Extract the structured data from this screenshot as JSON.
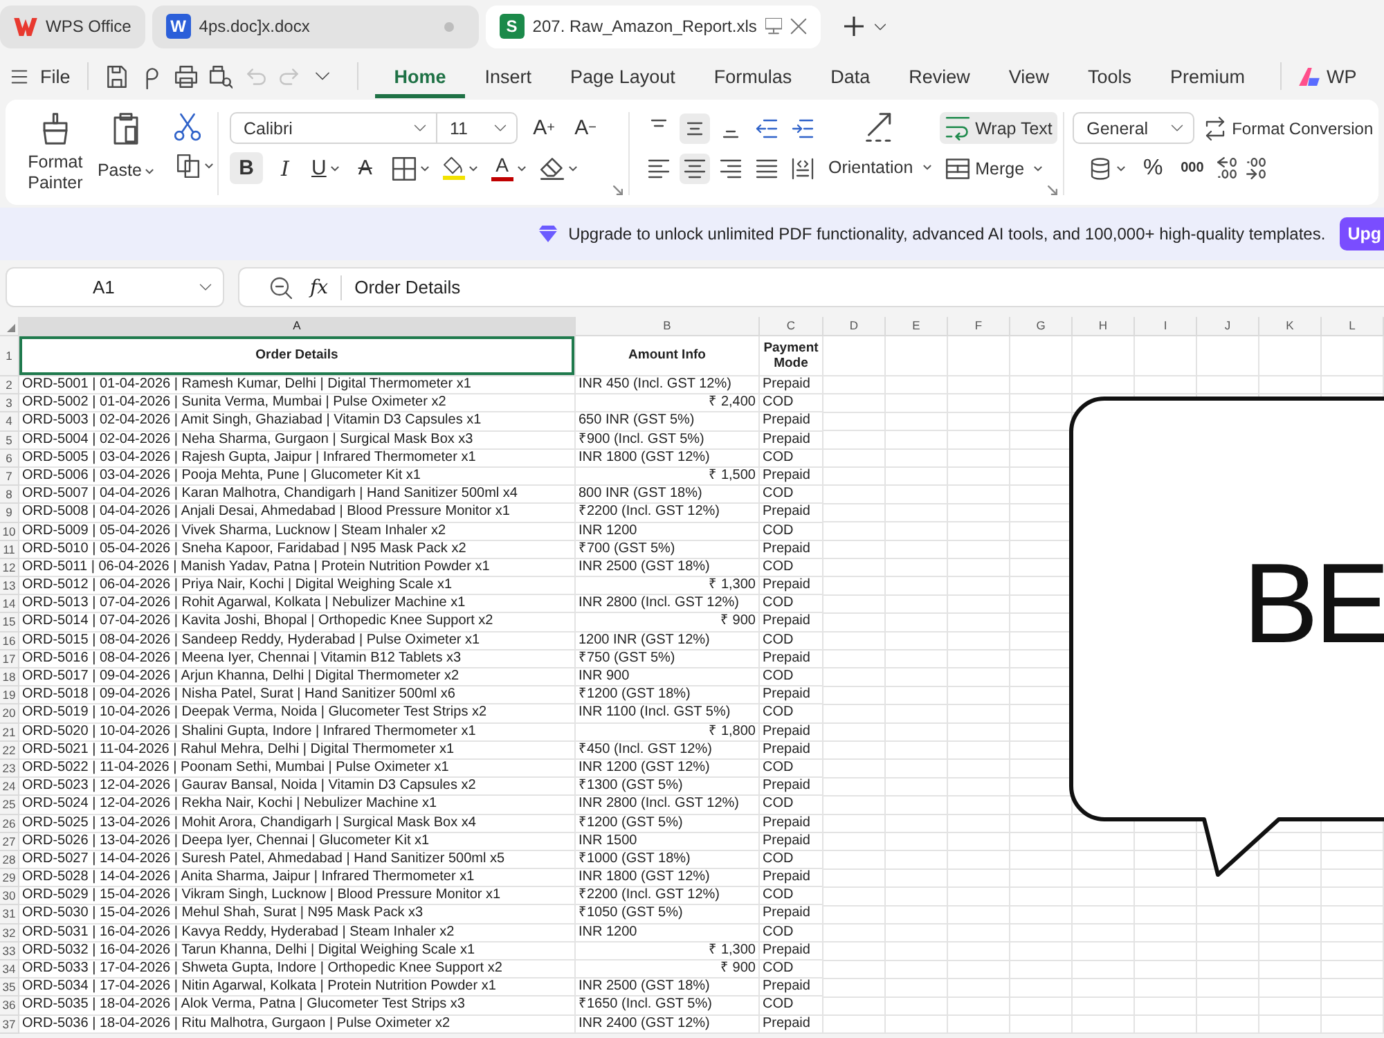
{
  "tabs": [
    {
      "kind": "home",
      "label": "WPS Office",
      "selected": false,
      "unsaved": false
    },
    {
      "kind": "writer",
      "badge": "W",
      "label": "4ps.doc]x.docx",
      "selected": false,
      "unsaved": true
    },
    {
      "kind": "sheet",
      "badge": "S",
      "label": "207. Raw_Amazon_Report.xls",
      "selected": true,
      "unsaved": false
    }
  ],
  "menu": {
    "file": "File",
    "quick_access": [
      {
        "kind": "save",
        "disabled": false
      },
      {
        "kind": "hook",
        "disabled": false
      },
      {
        "kind": "print",
        "disabled": false
      },
      {
        "kind": "preview",
        "disabled": false
      },
      {
        "kind": "undo",
        "disabled": true
      },
      {
        "kind": "redo",
        "disabled": true
      },
      {
        "kind": "more",
        "disabled": false
      }
    ],
    "tabs": [
      {
        "label": "Home",
        "selected": true
      },
      {
        "label": "Insert",
        "selected": false
      },
      {
        "label": "Page Layout",
        "selected": false
      },
      {
        "label": "Formulas",
        "selected": false
      },
      {
        "label": "Data",
        "selected": false
      },
      {
        "label": "Review",
        "selected": false
      },
      {
        "label": "View",
        "selected": false
      },
      {
        "label": "Tools",
        "selected": false
      },
      {
        "label": "Premium",
        "selected": false
      }
    ],
    "ai_label": "WP"
  },
  "ribbon": {
    "clipboard": {
      "format_painter": "Format Painter",
      "paste": "Paste"
    },
    "font": {
      "name": "Calibri",
      "size": "11",
      "grow": "A$^{+}$",
      "shrink": "A$^{−}$",
      "styles": [
        {
          "kind": "bold",
          "label": "B",
          "selected": true
        },
        {
          "kind": "italic",
          "label": "I",
          "selected": false
        },
        {
          "kind": "underline",
          "label": "U",
          "selected": false
        },
        {
          "kind": "strike",
          "label": "A",
          "selected": false
        }
      ],
      "colors": [
        {
          "kind": "highlight",
          "color": "#f2e200"
        },
        {
          "kind": "font",
          "label": "A",
          "color": "#c00000"
        }
      ]
    },
    "alignment": {
      "vertical": [
        {
          "kind": "top",
          "selected": false
        },
        {
          "kind": "middle",
          "selected": true
        },
        {
          "kind": "bottom",
          "selected": false
        }
      ],
      "horizontal": [
        {
          "kind": "left",
          "selected": false
        },
        {
          "kind": "center",
          "selected": true
        },
        {
          "kind": "right",
          "selected": false
        },
        {
          "kind": "justify",
          "selected": false
        },
        {
          "kind": "distributed",
          "selected": false
        }
      ],
      "orientation": "Orientation",
      "wrap_text": {
        "label": "Wrap Text",
        "selected": true
      },
      "merge": "Merge"
    },
    "number": {
      "format": "General",
      "conversion": "Format Conversion",
      "percent": "%",
      "thousands": "000"
    }
  },
  "banner": {
    "text": "Upgrade to unlock unlimited PDF functionality, advanced AI tools, and 100,000+ high-quality templates.",
    "button": "Upg"
  },
  "formula_bar": {
    "cell": "A1",
    "fx": "fx",
    "value": "Order Details"
  },
  "sheet": {
    "columns": [
      {
        "label": "A",
        "selected": true
      },
      {
        "label": "B",
        "selected": false
      },
      {
        "label": "C",
        "selected": false
      },
      {
        "label": "D",
        "selected": false
      },
      {
        "label": "E",
        "selected": false
      },
      {
        "label": "F",
        "selected": false
      },
      {
        "label": "G",
        "selected": false
      },
      {
        "label": "H",
        "selected": false
      },
      {
        "label": "I",
        "selected": false
      },
      {
        "label": "J",
        "selected": false
      },
      {
        "label": "K",
        "selected": false
      },
      {
        "label": "L",
        "selected": false
      }
    ],
    "header": {
      "number": "1",
      "cells": [
        {
          "text": "Order Details",
          "selected": true
        },
        {
          "text": "Amount Info",
          "selected": false
        },
        {
          "text": "Payment Mode",
          "selected": false
        }
      ]
    },
    "rows": [
      {
        "number": "2",
        "order": "ORD-5001 | 01-04-2026 | Ramesh Kumar, Delhi | Digital Thermometer x1",
        "amount": {
          "kind": "text",
          "text": "INR 450 (Incl. GST 12%)"
        },
        "payment": "Prepaid"
      },
      {
        "number": "3",
        "order": "ORD-5002 | 01-04-2026 | Sunita Verma, Mumbai | Pulse Oximeter x2",
        "amount": {
          "kind": "number",
          "text": "₹ 2,400"
        },
        "payment": "COD"
      },
      {
        "number": "4",
        "order": "ORD-5003 | 02-04-2026 | Amit Singh, Ghaziabad | Vitamin D3 Capsules x1",
        "amount": {
          "kind": "text",
          "text": "650 INR (GST 5%)"
        },
        "payment": "Prepaid"
      },
      {
        "number": "5",
        "order": "ORD-5004 | 02-04-2026 | Neha Sharma, Gurgaon | Surgical Mask Box x3",
        "amount": {
          "kind": "text",
          "text": "₹900 (Incl. GST 5%)"
        },
        "payment": "Prepaid"
      },
      {
        "number": "6",
        "order": "ORD-5005 | 03-04-2026 | Rajesh Gupta, Jaipur | Infrared Thermometer x1",
        "amount": {
          "kind": "text",
          "text": "INR 1800 (GST 12%)"
        },
        "payment": "COD"
      },
      {
        "number": "7",
        "order": "ORD-5006 | 03-04-2026 | Pooja Mehta, Pune | Glucometer Kit x1",
        "amount": {
          "kind": "number",
          "text": "₹ 1,500"
        },
        "payment": "Prepaid"
      },
      {
        "number": "8",
        "order": "ORD-5007 | 04-04-2026 | Karan Malhotra, Chandigarh | Hand Sanitizer 500ml x4",
        "amount": {
          "kind": "text",
          "text": "800 INR (GST 18%)"
        },
        "payment": "COD"
      },
      {
        "number": "9",
        "order": "ORD-5008 | 04-04-2026 | Anjali Desai, Ahmedabad | Blood Pressure Monitor x1",
        "amount": {
          "kind": "text",
          "text": "₹2200 (Incl. GST 12%)"
        },
        "payment": "Prepaid"
      },
      {
        "number": "10",
        "order": "ORD-5009 | 05-04-2026 | Vivek Sharma, Lucknow | Steam Inhaler x2",
        "amount": {
          "kind": "text",
          "text": "INR 1200"
        },
        "payment": "COD"
      },
      {
        "number": "11",
        "order": "ORD-5010 | 05-04-2026 | Sneha Kapoor, Faridabad | N95 Mask Pack x2",
        "amount": {
          "kind": "text",
          "text": "₹700 (GST 5%)"
        },
        "payment": "Prepaid"
      },
      {
        "number": "12",
        "order": "ORD-5011 | 06-04-2026 | Manish Yadav, Patna | Protein Nutrition Powder x1",
        "amount": {
          "kind": "text",
          "text": "INR 2500 (GST 18%)"
        },
        "payment": "COD"
      },
      {
        "number": "13",
        "order": "ORD-5012 | 06-04-2026 | Priya Nair, Kochi | Digital Weighing Scale x1",
        "amount": {
          "kind": "number",
          "text": "₹ 1,300"
        },
        "payment": "Prepaid"
      },
      {
        "number": "14",
        "order": "ORD-5013 | 07-04-2026 | Rohit Agarwal, Kolkata | Nebulizer Machine x1",
        "amount": {
          "kind": "text",
          "text": "INR 2800 (Incl. GST 12%)"
        },
        "payment": "COD"
      },
      {
        "number": "15",
        "order": "ORD-5014 | 07-04-2026 | Kavita Joshi, Bhopal | Orthopedic Knee Support x2",
        "amount": {
          "kind": "number",
          "text": "₹ 900"
        },
        "payment": "Prepaid"
      },
      {
        "number": "16",
        "order": "ORD-5015 | 08-04-2026 | Sandeep Reddy, Hyderabad | Pulse Oximeter x1",
        "amount": {
          "kind": "text",
          "text": "1200 INR (GST 12%)"
        },
        "payment": "COD"
      },
      {
        "number": "17",
        "order": "ORD-5016 | 08-04-2026 | Meena Iyer, Chennai | Vitamin B12 Tablets x3",
        "amount": {
          "kind": "text",
          "text": "₹750 (GST 5%)"
        },
        "payment": "Prepaid"
      },
      {
        "number": "18",
        "order": "ORD-5017 | 09-04-2026 | Arjun Khanna, Delhi | Digital Thermometer x2",
        "amount": {
          "kind": "text",
          "text": "INR 900"
        },
        "payment": "COD"
      },
      {
        "number": "19",
        "order": "ORD-5018 | 09-04-2026 | Nisha Patel, Surat | Hand Sanitizer 500ml x6",
        "amount": {
          "kind": "text",
          "text": "₹1200 (GST 18%)"
        },
        "payment": "Prepaid"
      },
      {
        "number": "20",
        "order": "ORD-5019 | 10-04-2026 | Deepak Verma, Noida | Glucometer Test Strips x2",
        "amount": {
          "kind": "text",
          "text": "INR 1100 (Incl. GST 5%)"
        },
        "payment": "COD"
      },
      {
        "number": "21",
        "order": "ORD-5020 | 10-04-2026 | Shalini Gupta, Indore | Infrared Thermometer x1",
        "amount": {
          "kind": "number",
          "text": "₹ 1,800"
        },
        "payment": "Prepaid"
      },
      {
        "number": "22",
        "order": "ORD-5021 | 11-04-2026 | Rahul Mehra, Delhi | Digital Thermometer x1",
        "amount": {
          "kind": "text",
          "text": "₹450 (Incl. GST 12%)"
        },
        "payment": "Prepaid"
      },
      {
        "number": "23",
        "order": "ORD-5022 | 11-04-2026 | Poonam Sethi, Mumbai | Pulse Oximeter x1",
        "amount": {
          "kind": "text",
          "text": "INR 1200 (GST 12%)"
        },
        "payment": "COD"
      },
      {
        "number": "24",
        "order": "ORD-5023 | 12-04-2026 | Gaurav Bansal, Noida | Vitamin D3 Capsules x2",
        "amount": {
          "kind": "text",
          "text": "₹1300 (GST 5%)"
        },
        "payment": "Prepaid"
      },
      {
        "number": "25",
        "order": "ORD-5024 | 12-04-2026 | Rekha Nair, Kochi | Nebulizer Machine x1",
        "amount": {
          "kind": "text",
          "text": "INR 2800 (Incl. GST 12%)"
        },
        "payment": "COD"
      },
      {
        "number": "26",
        "order": "ORD-5025 | 13-04-2026 | Mohit Arora, Chandigarh | Surgical Mask Box x4",
        "amount": {
          "kind": "text",
          "text": "₹1200 (GST 5%)"
        },
        "payment": "Prepaid"
      },
      {
        "number": "27",
        "order": "ORD-5026 | 13-04-2026 | Deepa Iyer, Chennai | Glucometer Kit x1",
        "amount": {
          "kind": "text",
          "text": "INR 1500"
        },
        "payment": "Prepaid"
      },
      {
        "number": "28",
        "order": "ORD-5027 | 14-04-2026 | Suresh Patel, Ahmedabad | Hand Sanitizer 500ml x5",
        "amount": {
          "kind": "text",
          "text": "₹1000 (GST 18%)"
        },
        "payment": "COD"
      },
      {
        "number": "29",
        "order": "ORD-5028 | 14-04-2026 | Anita Sharma, Jaipur | Infrared Thermometer x1",
        "amount": {
          "kind": "text",
          "text": "INR 1800 (GST 12%)"
        },
        "payment": "Prepaid"
      },
      {
        "number": "30",
        "order": "ORD-5029 | 15-04-2026 | Vikram Singh, Lucknow | Blood Pressure Monitor x1",
        "amount": {
          "kind": "text",
          "text": "₹2200 (Incl. GST 12%)"
        },
        "payment": "COD"
      },
      {
        "number": "31",
        "order": "ORD-5030 | 15-04-2026 | Mehul Shah, Surat | N95 Mask Pack x3",
        "amount": {
          "kind": "text",
          "text": "₹1050 (GST 5%)"
        },
        "payment": "Prepaid"
      },
      {
        "number": "32",
        "order": "ORD-5031 | 16-04-2026 | Kavya Reddy, Hyderabad | Steam Inhaler x2",
        "amount": {
          "kind": "text",
          "text": "INR 1200"
        },
        "payment": "COD"
      },
      {
        "number": "33",
        "order": "ORD-5032 | 16-04-2026 | Tarun Khanna, Delhi | Digital Weighing Scale x1",
        "amount": {
          "kind": "number",
          "text": "₹ 1,300"
        },
        "payment": "Prepaid"
      },
      {
        "number": "34",
        "order": "ORD-5033 | 17-04-2026 | Shweta Gupta, Indore | Orthopedic Knee Support x2",
        "amount": {
          "kind": "number",
          "text": "₹ 900"
        },
        "payment": "COD"
      },
      {
        "number": "35",
        "order": "ORD-5034 | 17-04-2026 | Nitin Agarwal, Kolkata | Protein Nutrition Powder x1",
        "amount": {
          "kind": "text",
          "text": "INR 2500 (GST 18%)"
        },
        "payment": "Prepaid"
      },
      {
        "number": "36",
        "order": "ORD-5035 | 18-04-2026 | Alok Verma, Patna | Glucometer Test Strips x3",
        "amount": {
          "kind": "text",
          "text": "₹1650 (Incl. GST 5%)"
        },
        "payment": "COD"
      },
      {
        "number": "37",
        "order": "ORD-5036 | 18-04-2026 | Ritu Malhotra, Gurgaon | Pulse Oximeter x2",
        "amount": {
          "kind": "text",
          "text": "INR 2400 (GST 12%)"
        },
        "payment": "Prepaid"
      }
    ]
  },
  "shape": {
    "text": "BE"
  }
}
